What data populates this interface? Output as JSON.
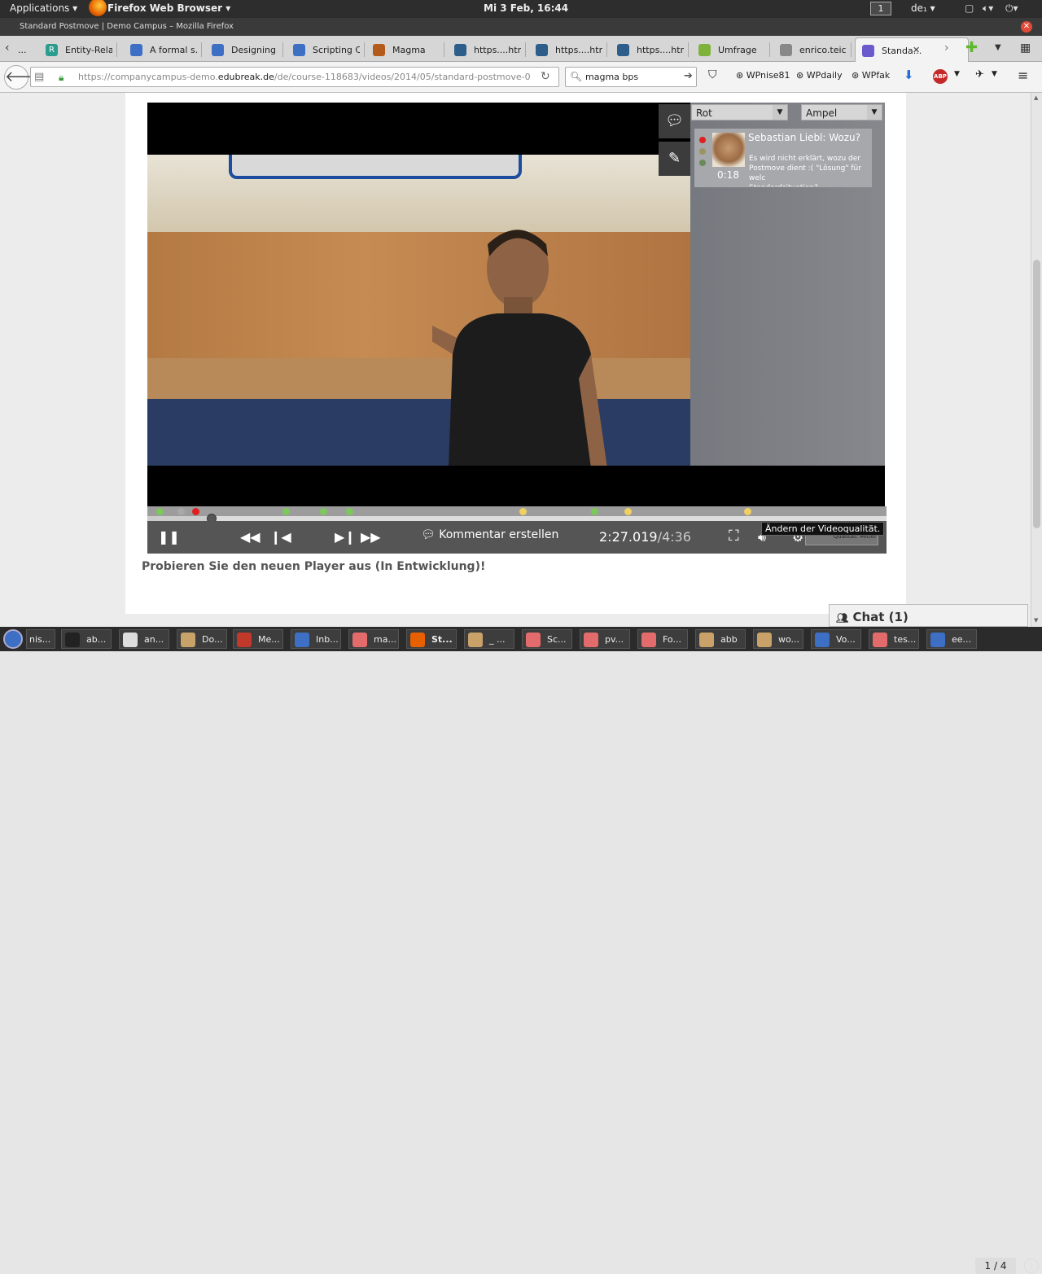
{
  "system": {
    "applications_label": "Applications",
    "browser_name": "Firefox Web Browser",
    "clock": "Mi  3 Feb, 16:44",
    "workspace": "1",
    "keyboard_layout": "de₁"
  },
  "window": {
    "title": "Standard Postmove | Demo Campus – Mozilla Firefox"
  },
  "tabs": [
    {
      "label": "...",
      "icon": "partial-tab",
      "color": "#666"
    },
    {
      "label": "Entity-Rela...",
      "icon": "R",
      "color": "#2a9d8f"
    },
    {
      "label": "A formal s...",
      "icon": "page-load",
      "color": "#3d6fc4"
    },
    {
      "label": "Designing I...",
      "icon": "page-load",
      "color": "#3d6fc4"
    },
    {
      "label": "Scripting C...",
      "icon": "page-load",
      "color": "#3d6fc4"
    },
    {
      "label": "Magma",
      "icon": "magma",
      "color": "#b45a1b"
    },
    {
      "label": "https....html",
      "icon": "hourglass",
      "color": "#2d5d8a"
    },
    {
      "label": "https....html",
      "icon": "hourglass",
      "color": "#2d5d8a"
    },
    {
      "label": "https....html",
      "icon": "hourglass",
      "color": "#2d5d8a"
    },
    {
      "label": "Umfrage",
      "icon": "leaf",
      "color": "#7fb23b"
    },
    {
      "label": "enrico.teic...",
      "icon": "doc",
      "color": "#888"
    },
    {
      "label": "Standa...",
      "icon": "edubreak",
      "color": "#6a5acd"
    }
  ],
  "navbar": {
    "url_prefix": "https://companycampus-demo.",
    "url_domain": "edubreak.de",
    "url_path": "/de/course-118683/videos/2014/05/standard-postmove-0",
    "search_query": "magma bps",
    "bookmarks": [
      "WPnise81",
      "WPdaily",
      "WPfak"
    ]
  },
  "player": {
    "dropdown_color": "Rot",
    "dropdown_mode": "Ampel",
    "comment": {
      "author_title": "Sebastian Liebl: Wozu?",
      "time": "0:18",
      "body": "Es wird nicht erklärt, wozu der\nPostmove dient :( \"Lösung\" für welc\nStandardsituation?"
    },
    "current_time": "2:27.019",
    "duration": "/4:36",
    "create_comment_label": "Kommentar erstellen",
    "tooltip": "Ändern der Videoqualität.",
    "quality_label": "Qualität: Mittel",
    "progress_fraction": 0.087,
    "markers": [
      {
        "color": "#7cc85a"
      },
      {
        "color": "#a8a8a8"
      },
      {
        "color": "#e02020"
      },
      {
        "color": "#7cc85a"
      },
      {
        "color": "#7cc85a"
      },
      {
        "color": "#7cc85a"
      },
      {
        "color": "#f0d060"
      },
      {
        "color": "#7cc85a"
      },
      {
        "color": "#f0d060"
      },
      {
        "color": "#f0d060"
      }
    ]
  },
  "page": {
    "promo": "Probieren Sie den neuen Player aus (In Entwicklung)!",
    "chat": "Chat (1)"
  },
  "taskbar": {
    "items": [
      {
        "label": "nis...",
        "color": "#3d6fc4"
      },
      {
        "label": "ab...",
        "color": "#222"
      },
      {
        "label": "an...",
        "color": "#ddd"
      },
      {
        "label": "Do...",
        "color": "#c9a26a"
      },
      {
        "label": "Me...",
        "color": "#c0392b"
      },
      {
        "label": "Inb...",
        "color": "#3d6fc4"
      },
      {
        "label": "ma...",
        "color": "#e46b6b"
      },
      {
        "label": "St...",
        "color": "#e66000"
      },
      {
        "label": "_ ...",
        "color": "#c9a26a"
      },
      {
        "label": "Sc...",
        "color": "#e46b6b"
      },
      {
        "label": "pv...",
        "color": "#e46b6b"
      },
      {
        "label": "Fo...",
        "color": "#e46b6b"
      },
      {
        "label": "abb",
        "color": "#c9a26a"
      },
      {
        "label": "wo...",
        "color": "#c9a26a"
      },
      {
        "label": "Vo...",
        "color": "#3d6fc4"
      },
      {
        "label": "tes...",
        "color": "#e46b6b"
      },
      {
        "label": "ee...",
        "color": "#3d6fc4"
      }
    ],
    "pager": "1 / 4"
  }
}
